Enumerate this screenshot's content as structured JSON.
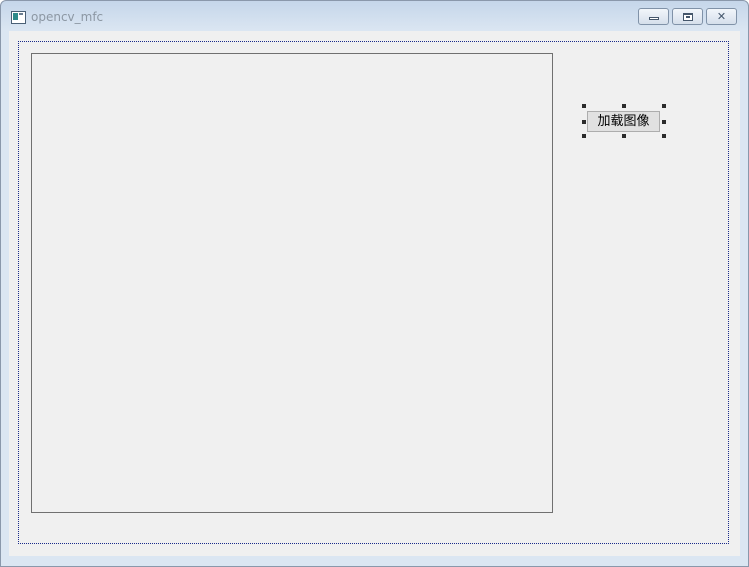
{
  "window": {
    "title": "opencv_mfc",
    "controls": {
      "minimize_glyph": "",
      "maximize_glyph": "",
      "close_glyph": "✕"
    }
  },
  "dialog": {
    "load_image_button": "加载图像"
  },
  "colors": {
    "client_background": "#f0f0f0",
    "frame_dotted": "#1a2a8a",
    "title_text": "#8c97a3"
  }
}
